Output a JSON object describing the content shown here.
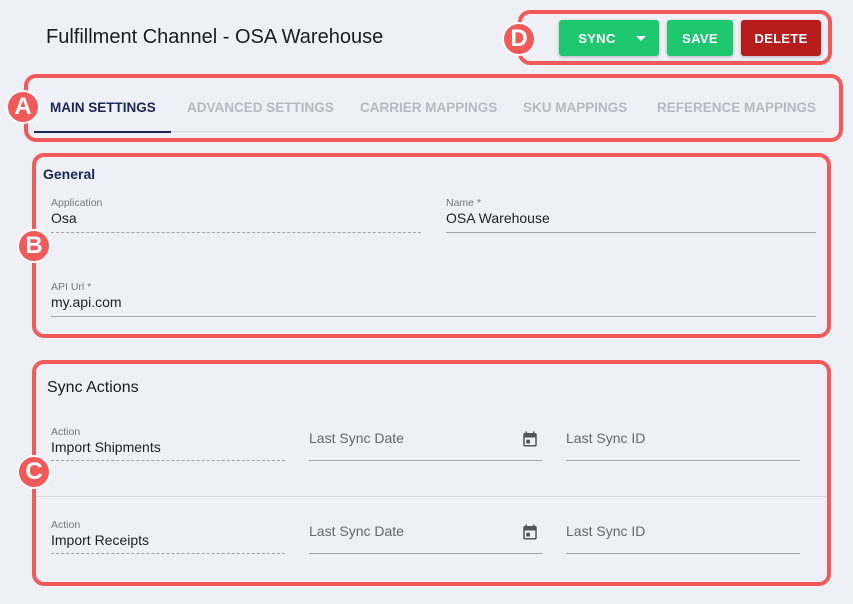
{
  "header": {
    "title": "Fulfillment Channel - OSA Warehouse",
    "sync_label": "SYNC",
    "save_label": "SAVE",
    "delete_label": "DELETE"
  },
  "tabs": [
    {
      "label": "MAIN SETTINGS",
      "active": true
    },
    {
      "label": "ADVANCED SETTINGS",
      "active": false
    },
    {
      "label": "CARRIER MAPPINGS",
      "active": false
    },
    {
      "label": "SKU MAPPINGS",
      "active": false
    },
    {
      "label": "REFERENCE MAPPINGS",
      "active": false
    }
  ],
  "general": {
    "title": "General",
    "application": {
      "label": "Application",
      "value": "Osa"
    },
    "name": {
      "label": "Name *",
      "value": "OSA Warehouse"
    },
    "api_url": {
      "label": "API Url *",
      "value": "my.api.com"
    }
  },
  "sync_actions": {
    "title": "Sync Actions",
    "rows": [
      {
        "action_label": "Action",
        "action_value": "Import Shipments",
        "last_sync_date": "Last Sync Date",
        "last_sync_id": "Last Sync ID"
      },
      {
        "action_label": "Action",
        "action_value": "Import Receipts",
        "last_sync_date": "Last Sync Date",
        "last_sync_id": "Last Sync ID"
      }
    ]
  },
  "annotations": [
    "A",
    "B",
    "C",
    "D"
  ],
  "colors": {
    "accent_green": "#1ec66f",
    "danger_red": "#b71c1c",
    "primary_navy": "#1c2556",
    "annotation_red": "#f25a5a"
  }
}
